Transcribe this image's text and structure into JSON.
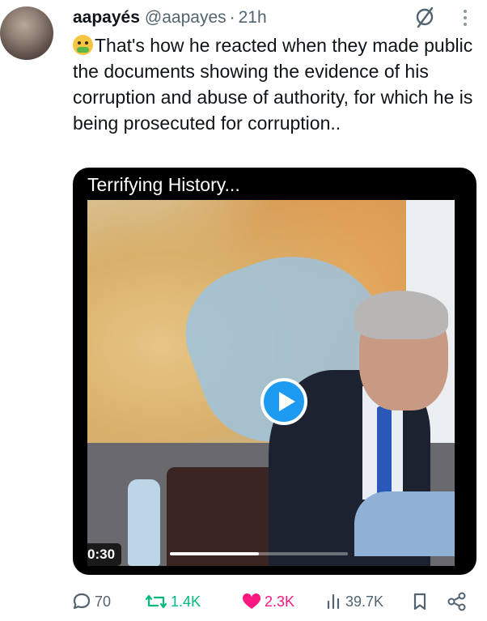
{
  "post": {
    "display_name": "aapayés",
    "handle": "@aapayes",
    "separator": "·",
    "time": "21h",
    "text": "That's how he reacted when they made public the documents showing the evidence of his corruption and abuse of authority, for which he is being prosecuted for corruption..",
    "emoji": "nauseated-face-emoji"
  },
  "media": {
    "caption": "Terrifying History...",
    "duration": "0:30",
    "progress": 0.5
  },
  "actions": {
    "replies": "70",
    "reposts": "1.4K",
    "likes": "2.3K",
    "views": "39.7K"
  },
  "colors": {
    "like": "#f91880",
    "repost": "#00ba7c",
    "icon": "#536471",
    "play": "#1d9bf0"
  },
  "icons": [
    "grok-icon",
    "more-icon",
    "reply-icon",
    "repost-icon",
    "heart-icon",
    "views-icon",
    "bookmark-icon",
    "share-icon"
  ]
}
